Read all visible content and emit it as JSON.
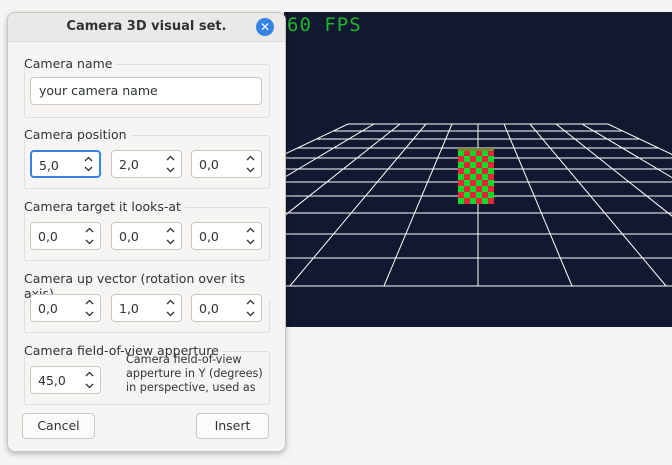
{
  "viewport": {
    "fps_text": "60 FPS",
    "background": "#121830",
    "fps_color": "#1fb52a"
  },
  "dialog": {
    "title": "Camera 3D visual set.",
    "close_icon": "close-icon",
    "accent": "#3584e4",
    "name_group": {
      "label": "Camera name",
      "value": "your camera name"
    },
    "position_group": {
      "label": "Camera position",
      "values": [
        "5,0",
        "2,0",
        "0,0"
      ]
    },
    "target_group": {
      "label": "Camera target it looks-at",
      "values": [
        "0,0",
        "0,0",
        "0,0"
      ]
    },
    "up_group": {
      "label": "Camera up vector (rotation over its axis)",
      "values": [
        "0,0",
        "1,0",
        "0,0"
      ]
    },
    "fov_group": {
      "label": "Camera field-of-view apperture",
      "value": "45,0",
      "description": "Camera field-of-view apperture in Y (degrees) in perspective, used as near"
    },
    "buttons": {
      "cancel": "Cancel",
      "insert": "Insert"
    }
  }
}
